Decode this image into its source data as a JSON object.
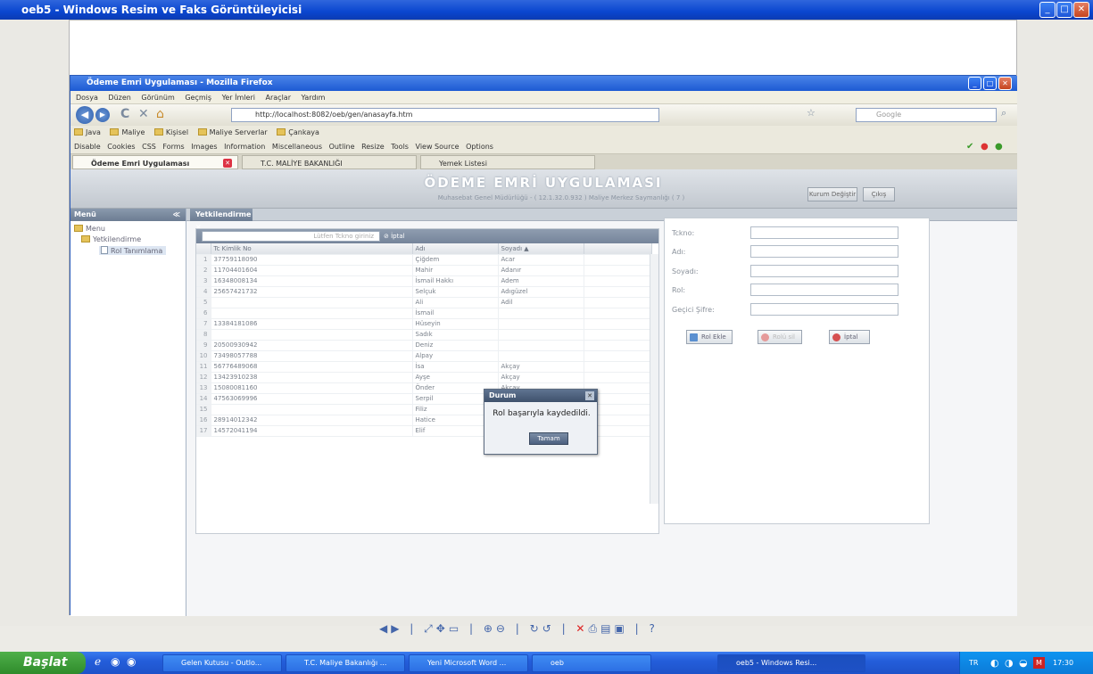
{
  "viewer": {
    "title": "oeb5 - Windows Resim ve Faks Görüntüleyicisi"
  },
  "firefox": {
    "title": "Ödeme Emri Uygulaması - Mozilla Firefox",
    "menu": [
      "Dosya",
      "Düzen",
      "Görünüm",
      "Geçmiş",
      "Yer İmleri",
      "Araçlar",
      "Yardım"
    ],
    "url": "http://localhost:8082/oeb/gen/anasayfa.htm",
    "search_placeholder": "Google",
    "bookmarks": [
      "Java",
      "Maliye",
      "Kişisel",
      "Maliye Serverlar",
      "Çankaya"
    ],
    "webdev": [
      "Disable",
      "Cookies",
      "CSS",
      "Forms",
      "Images",
      "Information",
      "Miscellaneous",
      "Outline",
      "Resize",
      "Tools",
      "View Source",
      "Options"
    ],
    "tabs": [
      "Ödeme Emri Uygulaması",
      "T.C. MALİYE BAKANLIĞI",
      "Yemek Listesi"
    ]
  },
  "app": {
    "title": "ÖDEME EMRİ UYGULAMASI",
    "subtitle": "Muhasebat Genel Müdürlüğü - ( 12.1.32.0.932 ) Maliye Merkez Saymanlığı ( 7 )",
    "btn_kurum": "Kurum Değiştir",
    "btn_cikis": "Çıkış",
    "left_header": "Menü",
    "tree": [
      "Menu",
      "Yetkilendirme",
      "Rol Tanımlama"
    ],
    "main_tab": "Yetkilendirme"
  },
  "grid": {
    "filter_placeholder": "Lütfen Tckno giriniz",
    "cancel_label": "İptal",
    "columns": [
      "Tc Kimlik No",
      "Adı",
      "Soyadı ▲"
    ],
    "rows": [
      [
        "1",
        "37759118090",
        "Çiğdem",
        "Acar"
      ],
      [
        "2",
        "11704401604",
        "Mahir",
        "Adanır"
      ],
      [
        "3",
        "16348008134",
        "İsmail Hakkı",
        "Adem"
      ],
      [
        "4",
        "25657421732",
        "Selçuk",
        "Adıgüzel"
      ],
      [
        "5",
        "",
        "Ali",
        "Adil"
      ],
      [
        "6",
        "",
        "İsmail",
        ""
      ],
      [
        "7",
        "13384181086",
        "Hüseyin",
        ""
      ],
      [
        "8",
        "",
        "Sadık",
        ""
      ],
      [
        "9",
        "20500930942",
        "Deniz",
        ""
      ],
      [
        "10",
        "73498057788",
        "Alpay",
        ""
      ],
      [
        "11",
        "56776489068",
        "İsa",
        "Akçay"
      ],
      [
        "12",
        "13423910238",
        "Ayşe",
        "Akçay"
      ],
      [
        "13",
        "15080081160",
        "Önder",
        "Akçay"
      ],
      [
        "14",
        "47563069996",
        "Serpil",
        "Akdemir"
      ],
      [
        "15",
        "",
        "Filiz",
        "Akdemir"
      ],
      [
        "16",
        "28914012342",
        "Hatice",
        "Akgönül"
      ],
      [
        "17",
        "14572041194",
        "Elif",
        "Akgönülü"
      ]
    ]
  },
  "form": {
    "labels": [
      "Tckno:",
      "Adı:",
      "Soyadı:",
      "Rol:",
      "Geçici Şifre:"
    ],
    "btn_save": "Rol Ekle",
    "btn_delete": "Rolü sil",
    "btn_cancel": "İptal"
  },
  "dialog": {
    "title": "Durum",
    "message": "Rol başarıyla kaydedildi.",
    "ok": "Tamam"
  },
  "taskbar": {
    "start": "Başlat",
    "items": [
      "Gelen Kutusu - Outlo...",
      "T.C. Maliye Bakanlığı ...",
      "Yeni Microsoft Word ...",
      "oeb",
      "oeb5 - Windows Resi..."
    ],
    "lang": "TR",
    "time": "17:30"
  }
}
